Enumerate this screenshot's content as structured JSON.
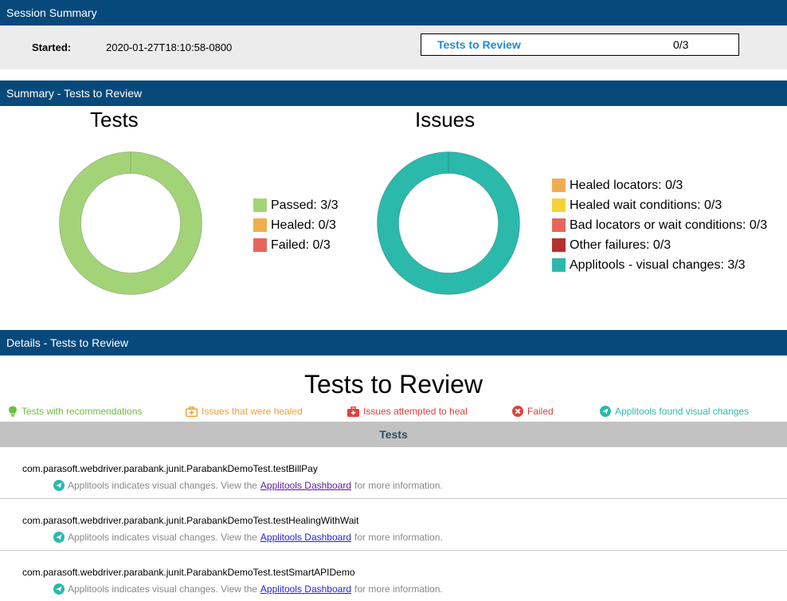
{
  "session": {
    "bar_title": "Session Summary",
    "started_label": "Started:",
    "started_value": "2020-01-27T18:10:58-0800",
    "review_link": "Tests to Review",
    "review_count": "0/3"
  },
  "summary": {
    "bar_title": "Summary - Tests to Review",
    "tests_chart_title": "Tests",
    "issues_chart_title": "Issues"
  },
  "chart_data": [
    {
      "type": "pie",
      "title": "Tests",
      "categories": [
        "Passed",
        "Healed",
        "Failed"
      ],
      "values": [
        3,
        0,
        0
      ],
      "total": 3,
      "colors": [
        "#a3d377",
        "#f0ad4e",
        "#e8655e"
      ],
      "legend_labels": [
        "Passed: 3/3",
        "Healed: 0/3",
        "Failed: 0/3"
      ],
      "legend": "right"
    },
    {
      "type": "pie",
      "title": "Issues",
      "categories": [
        "Healed locators",
        "Healed wait conditions",
        "Bad locators or wait conditions",
        "Other failures",
        "Applitools - visual changes"
      ],
      "values": [
        0,
        0,
        0,
        0,
        3
      ],
      "total": 3,
      "colors": [
        "#f0ad4e",
        "#f7d13c",
        "#e8655e",
        "#b5302f",
        "#2bb9ab"
      ],
      "legend_labels": [
        "Healed locators: 0/3",
        "Healed wait conditions: 0/3",
        "Bad locators or wait conditions: 0/3",
        "Other failures: 0/3",
        "Applitools - visual changes: 3/3"
      ],
      "legend": "right"
    }
  ],
  "details": {
    "bar_title": "Details - Tests to Review",
    "big_title": "Tests to Review",
    "filters": [
      {
        "label": "Tests with recommendations",
        "icon": "lightbulb-icon",
        "color": "#6cbf3f"
      },
      {
        "label": "Issues that were healed",
        "icon": "first-aid-kit-icon",
        "color": "#f0a030"
      },
      {
        "label": "Issues attempted to heal",
        "icon": "medical-kit-icon",
        "color": "#e0403c"
      },
      {
        "label": "Failed",
        "icon": "x-circle-icon",
        "color": "#e0403c"
      },
      {
        "label": "Applitools found visual changes",
        "icon": "applitools-icon",
        "color": "#2bb9ab"
      }
    ],
    "tests_header": "Tests",
    "tests": [
      {
        "name": "com.parasoft.webdriver.parabank.junit.ParabankDemoTest.testBillPay",
        "note_prefix": "Applitools indicates visual changes. View the",
        "link": "Applitools Dashboard",
        "note_suffix": "for more information."
      },
      {
        "name": "com.parasoft.webdriver.parabank.junit.ParabankDemoTest.testHealingWithWait",
        "note_prefix": "Applitools indicates visual changes. View the",
        "link": "Applitools Dashboard",
        "note_suffix": "for more information."
      },
      {
        "name": "com.parasoft.webdriver.parabank.junit.ParabankDemoTest.testSmartAPIDemo",
        "note_prefix": "Applitools indicates visual changes. View the",
        "link": "Applitools Dashboard",
        "note_suffix": "for more information."
      }
    ]
  }
}
